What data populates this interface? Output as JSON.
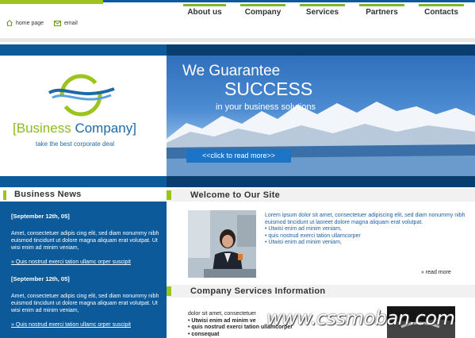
{
  "nav": {
    "items": [
      "About us",
      "Company",
      "Services",
      "Partners",
      "Contacts"
    ]
  },
  "toplinks": {
    "home": "home page",
    "email": "email"
  },
  "logo": {
    "bracket_open": "[",
    "name_part1": "Business",
    "name_part2": " Company",
    "bracket_close": "]",
    "tagline": "take the best corporate deal"
  },
  "hero": {
    "line1": "We Guarantee",
    "line2": "SUCCESS",
    "line3": "in your business solutions",
    "button": "<<click to read more>>"
  },
  "news": {
    "heading": "Business News",
    "items": [
      {
        "date": "[September 12th, 05]",
        "text": "Amet, consectetuer adipis cing elit, sed diam nonummy nibh euismod tincidunt ut dolore magna aliquam erat volutpat. Ut wisi enim ad minim veniam,",
        "link": "» Quis nostrud exerci tation ullamc orper suscipit"
      },
      {
        "date": "[September 12th, 05]",
        "text": "Amet, consectetuer adipis cing elit, sed diam nonummy nibh euismod tincidunt ut dolore magna aliquam erat volutpat. Ut wisi enim ad minim veniam,",
        "link": "» Quis nostrud exerci tation ullamc orper suscipit"
      }
    ]
  },
  "welcome": {
    "heading": "Welcome  to Our Site",
    "paragraph": "Lorem ipsum dolor sit amet, consectetuer adipiscing elit, sed diam nonummy nibh euismod tincidunt ut laoreet dolore magna aliquam erat volutpat.",
    "bullets": [
      "• Utwisi enim ad minim veniam,",
      "• quis nostrud exerci tation ullamcorper",
      "• Utwisi enim ad minim veniam,"
    ],
    "more": "» read more"
  },
  "services": {
    "heading": "Company Services Information",
    "line1": "dolor sit amet, consectetuer",
    "bullets": [
      "• Utwisi enim ad minim ve",
      "• quis nostrud exerci tation ullamcorper",
      "• consequat"
    ]
  },
  "watermark": "www.cssmoban.com",
  "colors": {
    "brand_blue": "#0c5a99",
    "dark_blue": "#073d6f",
    "accent_green": "#9cc41c"
  }
}
